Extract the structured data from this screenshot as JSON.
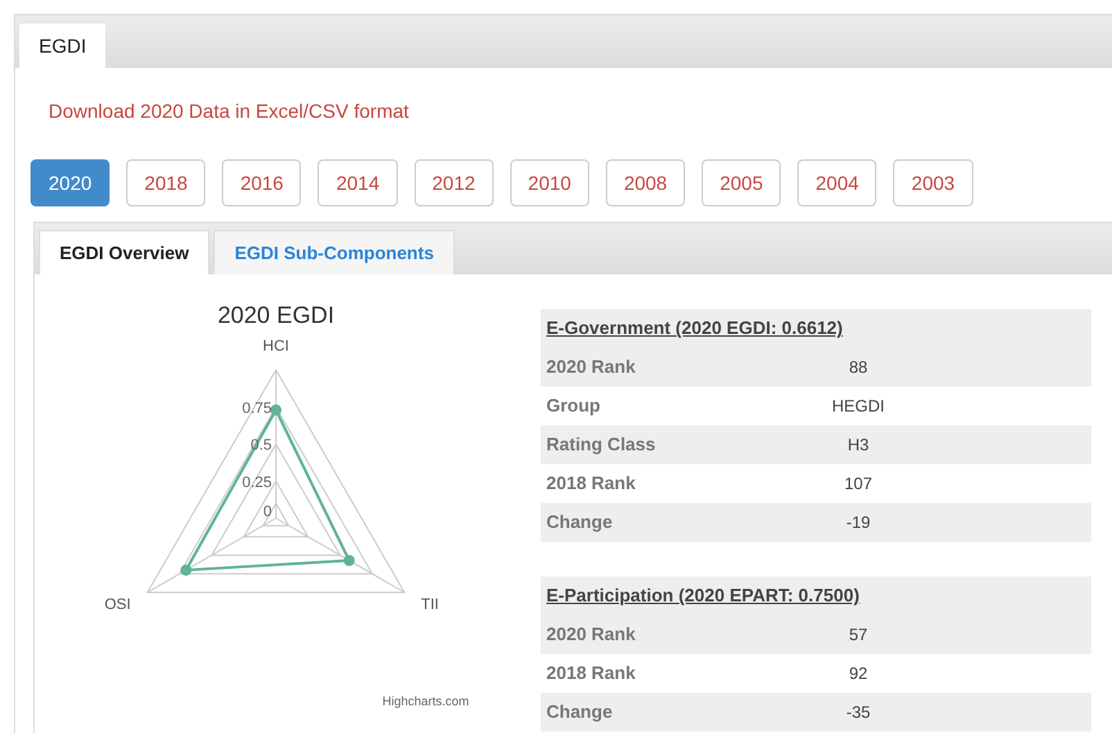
{
  "top_tabs": [
    {
      "label": "EGDI",
      "selected": true
    }
  ],
  "download_link": "Download 2020 Data in Excel/CSV format",
  "years": [
    {
      "label": "2020",
      "selected": true
    },
    {
      "label": "2018",
      "selected": false
    },
    {
      "label": "2016",
      "selected": false
    },
    {
      "label": "2014",
      "selected": false
    },
    {
      "label": "2012",
      "selected": false
    },
    {
      "label": "2010",
      "selected": false
    },
    {
      "label": "2008",
      "selected": false
    },
    {
      "label": "2005",
      "selected": false
    },
    {
      "label": "2004",
      "selected": false
    },
    {
      "label": "2003",
      "selected": false
    }
  ],
  "sub_tabs": [
    {
      "label": "EGDI Overview",
      "selected": true
    },
    {
      "label": "EGDI Sub-Components",
      "selected": false
    }
  ],
  "chart": {
    "title": "2020 EGDI",
    "axes": [
      "HCI",
      "TII",
      "OSI"
    ],
    "ticks": [
      "0.75",
      "0.5",
      "0.25",
      "0"
    ],
    "credit": "Highcharts.com"
  },
  "sections": [
    {
      "heading": "E-Government (2020 EGDI: 0.6612)",
      "rows": [
        {
          "label": "2020 Rank",
          "value": "88"
        },
        {
          "label": "Group",
          "value": "HEGDI"
        },
        {
          "label": "Rating Class",
          "value": "H3"
        },
        {
          "label": "2018 Rank",
          "value": "107"
        },
        {
          "label": "Change",
          "value": "-19"
        }
      ]
    },
    {
      "heading": "E-Participation (2020 EPART: 0.7500)",
      "rows": [
        {
          "label": "2020 Rank",
          "value": "57"
        },
        {
          "label": "2018 Rank",
          "value": "92"
        },
        {
          "label": "Change",
          "value": "-35"
        }
      ]
    }
  ]
}
